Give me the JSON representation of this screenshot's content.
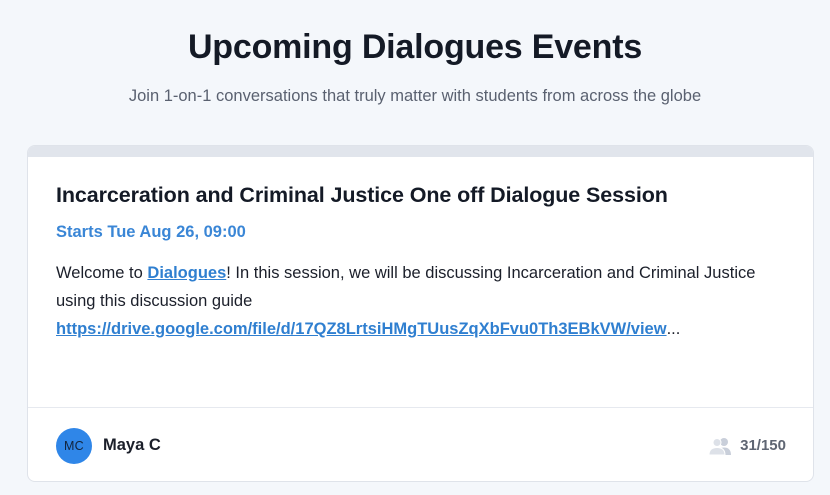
{
  "header": {
    "title": "Upcoming Dialogues Events",
    "subtitle": "Join 1-on-1 conversations that truly matter with students from across the globe"
  },
  "event": {
    "title": "Incarceration and Criminal Justice One off Dialogue Session",
    "start": "Starts Tue Aug 26, 09:00",
    "desc_prefix": "Welcome to ",
    "desc_link": "Dialogues",
    "desc_suffix": "! In this session, we will be discussing Incarceration and Criminal Justice using this discussion guide ",
    "guide_link": "https://drive.google.com/file/d/17QZ8LrtsiHMgTUusZqXbFvu0Th3EBkVW/view",
    "ellipsis": "..."
  },
  "host": {
    "initials": "MC",
    "name": "Maya C"
  },
  "capacity": {
    "text": "31/150",
    "icon": "people-icon"
  },
  "colors": {
    "accent": "#3a86d6",
    "avatar": "#2f86e8"
  }
}
